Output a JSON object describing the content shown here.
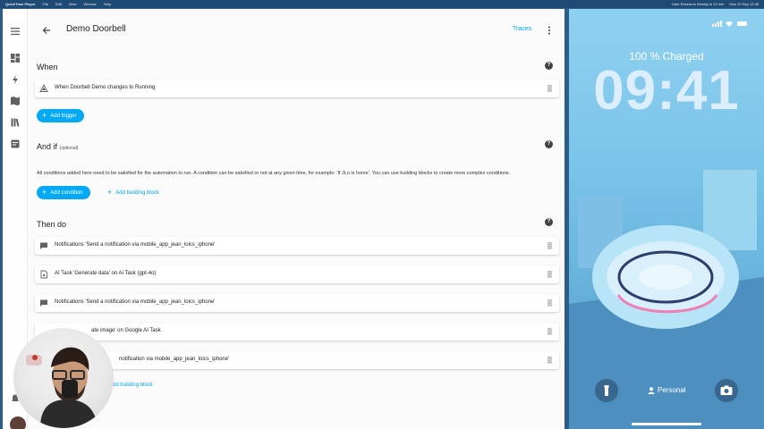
{
  "menubar": {
    "app": "QuickTime Player",
    "items": [
      "File",
      "Edit",
      "View",
      "Window",
      "Help"
    ],
    "right_text": "User Research Weekly in 22 min",
    "clock": "Mon 22 Sep 12:38"
  },
  "header": {
    "title": "Demo Doorbell",
    "traces": "Traces"
  },
  "when": {
    "title": "When",
    "trigger": "When Doorbell Demo changes to Running",
    "add_trigger": "Add trigger"
  },
  "and_if": {
    "title": "And if",
    "optional": "(optional)",
    "description": "All conditions added here need to be satisfied for the automation to run. A condition can be satisfied or not at any given time, for example: 'If JLo is home'. You can use building blocks to create more complex conditions.",
    "add_condition": "Add condition",
    "add_building_block": "Add building block"
  },
  "then_do": {
    "title": "Then do",
    "actions": [
      "Notifications 'Send a notification via mobile_app_jean_loics_iphone'",
      "AI Task 'Generate data' on Ai Task (gpt-4o)",
      "Notifications 'Send a notification via mobile_app_jean_loics_iphone'",
      "ate image' on Google AI Task",
      "notification via mobile_app_jean_loics_iphone'"
    ],
    "add_building_block": "Add building block"
  },
  "phone": {
    "charged": "100 % Charged",
    "clock": "09:41",
    "focus": "Personal"
  },
  "colors": {
    "accent": "#03a9f4",
    "icon": "#616161"
  }
}
